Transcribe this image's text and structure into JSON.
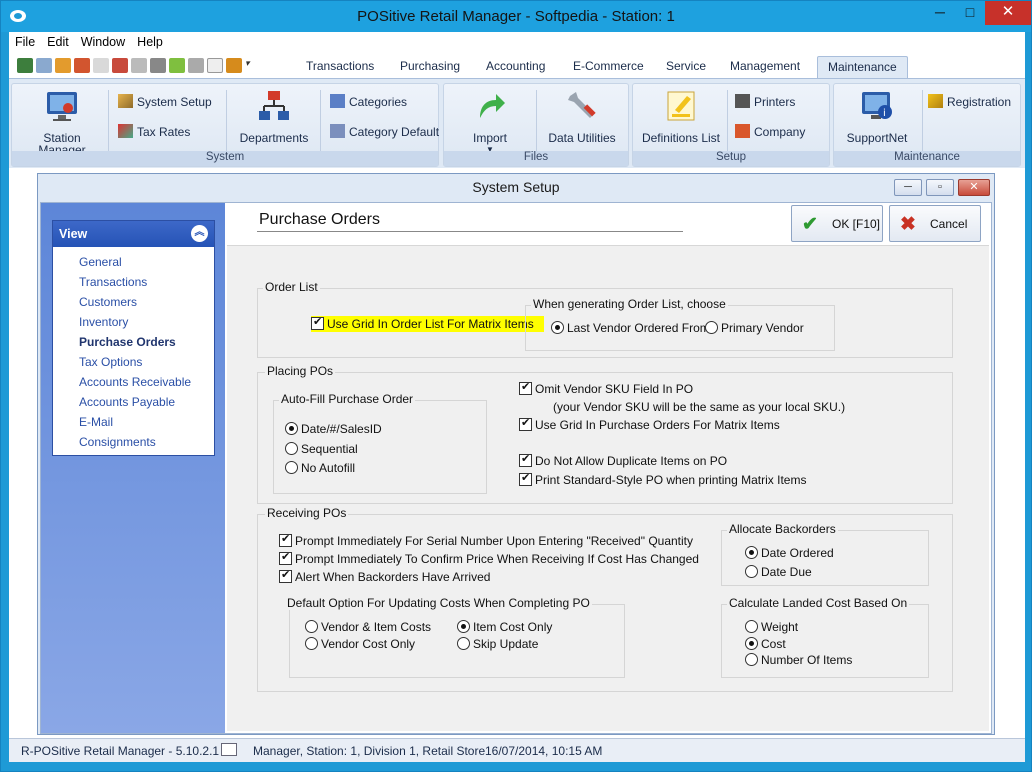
{
  "window": {
    "title": "POSitive Retail Manager - Softpedia - Station: 1",
    "minimize": "─",
    "close": "✕"
  },
  "menu": [
    "File",
    "Edit",
    "Window",
    "Help"
  ],
  "ribbon_tabs": [
    "Transactions",
    "Purchasing",
    "Accounting",
    "E-Commerce",
    "Service",
    "Management",
    "Maintenance"
  ],
  "ribbon": {
    "system": {
      "label": "System",
      "station_manager": "Station Manager",
      "system_setup": "System Setup",
      "tax_rates": "Tax Rates",
      "departments": "Departments",
      "categories": "Categories",
      "category_default": "Category Default"
    },
    "files": {
      "label": "Files",
      "import": "Import",
      "data_utilities": "Data Utilities"
    },
    "setup": {
      "label": "Setup",
      "definitions_list": "Definitions List",
      "printers": "Printers",
      "company": "Company"
    },
    "maintenance": {
      "label": "Maintenance",
      "supportnet": "SupportNet",
      "registration": "Registration"
    }
  },
  "dialog": {
    "title": "System Setup",
    "nav_header": "View",
    "nav_items": [
      "General",
      "Transactions",
      "Customers",
      "Inventory",
      "Purchase Orders",
      "Tax Options",
      "Accounts Receivable",
      "Accounts Payable",
      "E-Mail",
      "Consignments"
    ],
    "page_title": "Purchase Orders",
    "ok_label": "OK [F10]",
    "cancel_label": "Cancel",
    "order_list": {
      "legend": "Order List",
      "use_grid": "Use Grid In Order List For Matrix Items",
      "use_grid_checked": true,
      "choose_legend": "When generating Order List, choose",
      "last_vendor": "Last Vendor Ordered From",
      "primary_vendor": "Primary Vendor",
      "selected": "last_vendor"
    },
    "placing": {
      "legend": "Placing POs",
      "autofill_legend": "Auto-Fill Purchase Order",
      "autofill_options": [
        "Date/#/SalesID",
        "Sequential",
        "No Autofill"
      ],
      "autofill_selected": 0,
      "omit_sku": "Omit Vendor SKU Field In PO",
      "omit_sku_note": "(your Vendor SKU will be the same as your local SKU.)",
      "use_grid_po": "Use Grid In Purchase Orders For Matrix Items",
      "no_duplicates": "Do Not Allow Duplicate Items on PO",
      "print_standard": "Print Standard-Style PO when printing Matrix Items"
    },
    "receiving": {
      "legend": "Receiving POs",
      "prompt_serial": "Prompt Immediately For Serial Number Upon Entering \"Received\" Quantity",
      "prompt_price": "Prompt Immediately To Confirm Price When Receiving If Cost Has Changed",
      "alert_backorders": "Alert When Backorders Have Arrived",
      "update_costs_legend": "Default Option For Updating Costs When Completing PO",
      "update_options": [
        "Vendor & Item Costs",
        "Item Cost Only",
        "Vendor Cost Only",
        "Skip Update"
      ],
      "update_selected": 1,
      "allocate_legend": "Allocate Backorders",
      "allocate_options": [
        "Date Ordered",
        "Date Due"
      ],
      "allocate_selected": 0,
      "landed_legend": "Calculate Landed Cost Based On",
      "landed_options": [
        "Weight",
        "Cost",
        "Number Of Items"
      ],
      "landed_selected": 1
    }
  },
  "status": {
    "app": "R-POSitive Retail Manager - 5.10.2.1",
    "info": "Manager, Station: 1, Division 1, Retail Store",
    "datetime": "16/07/2014, 10:15 AM"
  }
}
